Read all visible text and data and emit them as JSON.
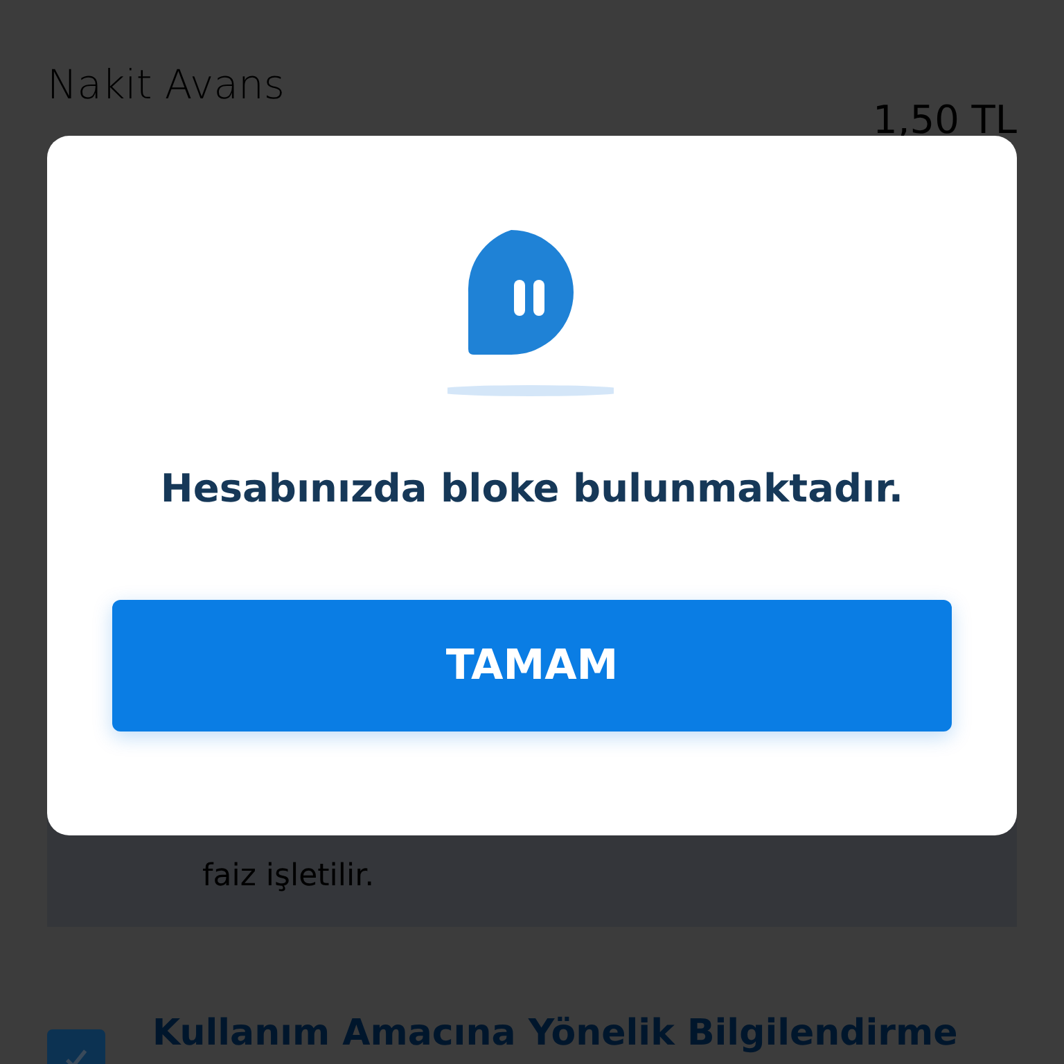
{
  "background": {
    "title": "Nakit Avans",
    "amount": "1,50 TL",
    "info_text": "faiz işletilir.",
    "section": {
      "title": "Kullanım Amacına Yönelik Bilgilendirme",
      "checked": true
    }
  },
  "dialog": {
    "message": "Hesabınızda bloke bulunmaktadır.",
    "button": "TAMAM"
  }
}
